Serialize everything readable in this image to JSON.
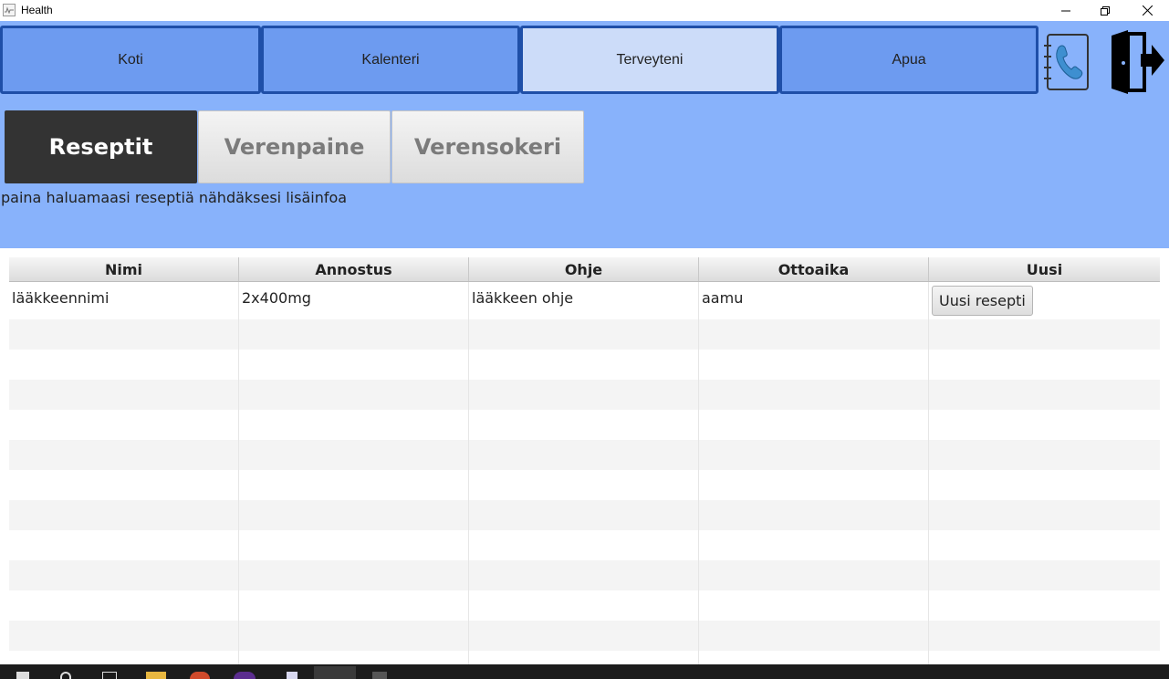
{
  "window": {
    "title": "Health"
  },
  "nav": {
    "items": [
      {
        "label": "Koti",
        "active": false
      },
      {
        "label": "Kalenteri",
        "active": false
      },
      {
        "label": "Terveyteni",
        "active": true
      },
      {
        "label": "Apua",
        "active": false
      }
    ],
    "icons": [
      "phone-book-icon",
      "exit-door-icon"
    ]
  },
  "subtabs": [
    {
      "label": "Reseptit",
      "active": true
    },
    {
      "label": "Verenpaine",
      "active": false
    },
    {
      "label": "Verensokeri",
      "active": false
    }
  ],
  "hint": "paina haluamaasi reseptiä nähdäksesi lisäinfoa",
  "table": {
    "columns": [
      "Nimi",
      "Annostus",
      "Ohje",
      "Ottoaika",
      "Uusi"
    ],
    "rows": [
      {
        "nimi": "lääkkeennimi",
        "annostus": "2x400mg",
        "ohje": "lääkkeen ohje",
        "ottoaika": "aamu",
        "button": "Uusi resepti"
      }
    ]
  },
  "colors": {
    "header_bg": "#88b2fb",
    "nav_border": "#1f4fa8",
    "nav_bg": "#6d9bf0",
    "nav_active_bg": "#ccdcf9",
    "subtab_active_bg": "#333333"
  }
}
